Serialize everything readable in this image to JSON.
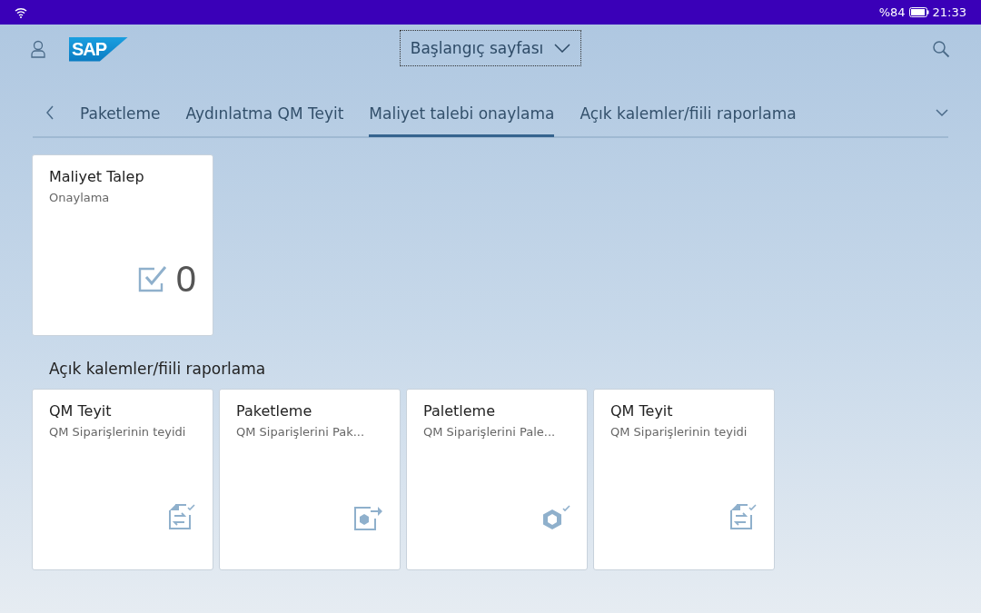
{
  "status_bar": {
    "battery_text": "%84",
    "time": "21:33"
  },
  "header": {
    "logo": "SAP",
    "title": "Başlangıç sayfası"
  },
  "tabs": [
    {
      "label": "Paketleme",
      "selected": false
    },
    {
      "label": "Aydınlatma QM Teyit",
      "selected": false
    },
    {
      "label": "Maliyet talebi onaylama",
      "selected": true
    },
    {
      "label": "Açık kalemler/fiili raporlama",
      "selected": false
    }
  ],
  "groups": [
    {
      "tiles": [
        {
          "title": "Maliyet Talep",
          "subtitle": "Onaylama",
          "kind": "approval",
          "count": "0"
        }
      ]
    },
    {
      "title": "Açık kalemler/fiili raporlama",
      "tiles": [
        {
          "title": "QM Teyit",
          "subtitle": "QM Siparişlerinin teyidi",
          "kind": "transfer"
        },
        {
          "title": "Paketleme",
          "subtitle": "QM Siparişlerini Pak...",
          "kind": "export"
        },
        {
          "title": "Paletleme",
          "subtitle": "QM Siparişlerini Pale...",
          "kind": "cubes"
        },
        {
          "title": "QM Teyit",
          "subtitle": "QM Siparişlerinin teyidi",
          "kind": "transfer"
        }
      ]
    }
  ]
}
